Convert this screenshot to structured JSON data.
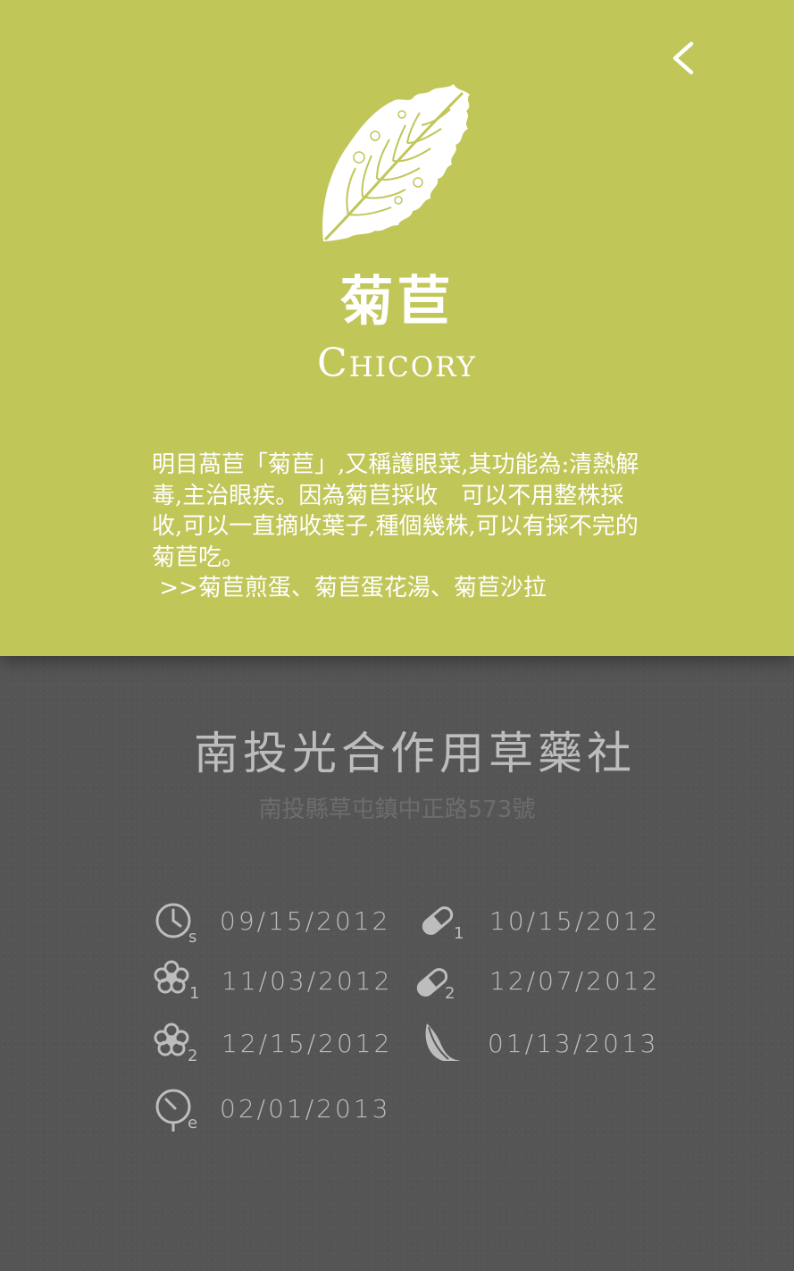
{
  "plant": {
    "name_zh": "菊苣",
    "name_en": "Chicory",
    "description": "明目萵苣「菊苣」,又稱護眼菜,其功能為:清熱解毒,主治眼疾。因為菊苣採收　可以不用整株採收,可以一直摘收葉子,種個幾株,可以有採不完的菊苣吃。\n >>菊苣煎蛋、菊苣蛋花湯、菊苣沙拉"
  },
  "org": {
    "name": "南投光合作用草藥社",
    "address": "南投縣草屯鎮中正路573號"
  },
  "schedule": [
    {
      "icon": "clock-icon",
      "sub": "s",
      "date": "09/15/2012"
    },
    {
      "icon": "pill-icon",
      "sub": "1",
      "date": "10/15/2012"
    },
    {
      "icon": "flower-icon",
      "sub": "1",
      "date": "11/03/2012"
    },
    {
      "icon": "pill-icon",
      "sub": "2",
      "date": "12/07/2012"
    },
    {
      "icon": "flower-icon",
      "sub": "2",
      "date": "12/15/2012"
    },
    {
      "icon": "leaf-icon",
      "sub": "",
      "date": "01/13/2013"
    },
    {
      "icon": "clock-icon",
      "sub": "e",
      "date": "02/01/2013"
    }
  ],
  "colors": {
    "top_bg": "#c1c659",
    "bottom_bg": "#575757",
    "text_light": "#bdbdbd",
    "address_text": "#6d6d6d"
  }
}
